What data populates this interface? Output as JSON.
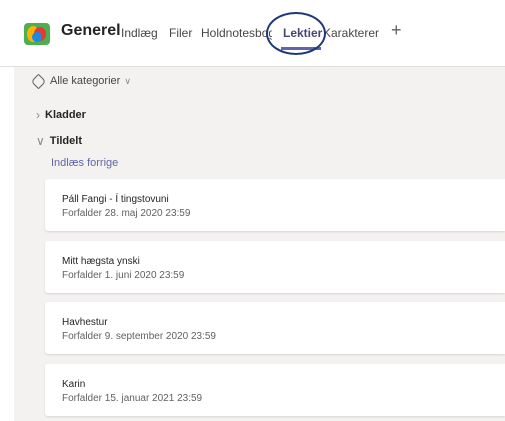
{
  "header": {
    "team_name": "Generel",
    "tabs": [
      "Indlæg",
      "Filer",
      "Holdnotesbog",
      "Lektier",
      "Karakterer"
    ],
    "active_tab": "Lektier",
    "add_tab_symbol": "+"
  },
  "filter": {
    "label": "Alle kategorier",
    "icon": "tag-icon",
    "dropdown_icon": "chevron-down-icon"
  },
  "sections": {
    "drafts": {
      "label": "Kladder",
      "expanded": false
    },
    "assigned": {
      "label": "Tildelt",
      "expanded": true
    }
  },
  "load_previous": "Indlæs forrige",
  "assignments": [
    {
      "title": "Páll Fangi - Í tingstovuni",
      "due": "Forfalder 28. maj 2020 23:59"
    },
    {
      "title": "Mitt hægsta ynski",
      "due": "Forfalder 1. juni 2020 23:59"
    },
    {
      "title": "Havhestur",
      "due": "Forfalder 9. september 2020 23:59"
    },
    {
      "title": "Karin",
      "due": "Forfalder 15. januar 2021 23:59"
    }
  ],
  "colors": {
    "accent": "#6264a7",
    "background": "#f3f2f1",
    "annotation_circle": "#1f3a7a"
  }
}
